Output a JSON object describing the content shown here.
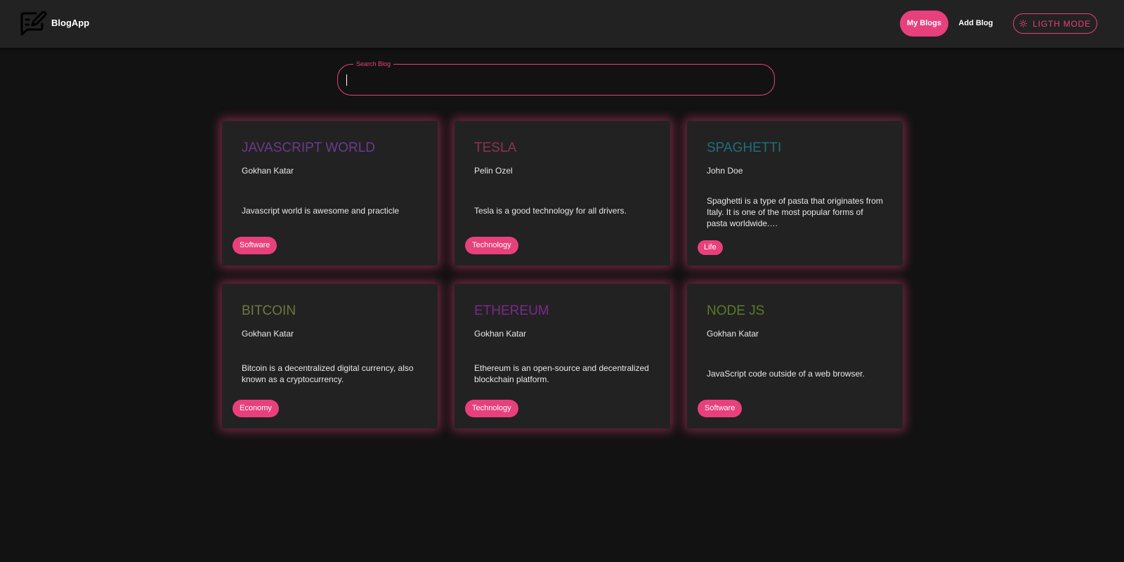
{
  "app": {
    "name": "BlogApp"
  },
  "nav": {
    "my_blogs": "My Blogs",
    "add_blog": "Add Blog",
    "mode_toggle": "LIGTH MODE",
    "mode_icon": "sun-icon"
  },
  "search": {
    "label": "Search Blog",
    "value": ""
  },
  "colors": {
    "accent": "#e8407c",
    "background": "#121212",
    "surface": "#222222"
  },
  "blogs": [
    {
      "title": "JAVASCRIPT WORLD",
      "author": "Gokhan Katar",
      "description": "Javascript world is awesome and practicle",
      "category": "Software",
      "title_color": "#6b3a8c"
    },
    {
      "title": "TESLA",
      "author": "Pelin Ozel",
      "description": "Tesla is a good technology for all drivers.",
      "category": "Technology",
      "title_color": "#8a3555"
    },
    {
      "title": "SPAGHETTI",
      "author": "John Doe",
      "description": "Spaghetti is a type of pasta that originates from Italy. It is one of the most popular forms of pasta worldwide.…",
      "category": "Life",
      "title_color": "#1f6f7a"
    },
    {
      "title": "BITCOIN",
      "author": "Gokhan Katar",
      "description": "Bitcoin is a decentralized digital currency, also known as a cryptocurrency.",
      "category": "Economy",
      "title_color": "#6d7a3a"
    },
    {
      "title": "ETHEREUM",
      "author": "Gokhan Katar",
      "description": "Ethereum is an open-source and decentralized blockchain platform.",
      "category": "Technology",
      "title_color": "#7a2a8a"
    },
    {
      "title": "NODE JS",
      "author": "Gokhan Katar",
      "description": "JavaScript code outside of a web browser.",
      "category": "Software",
      "title_color": "#5c7a2a"
    }
  ]
}
